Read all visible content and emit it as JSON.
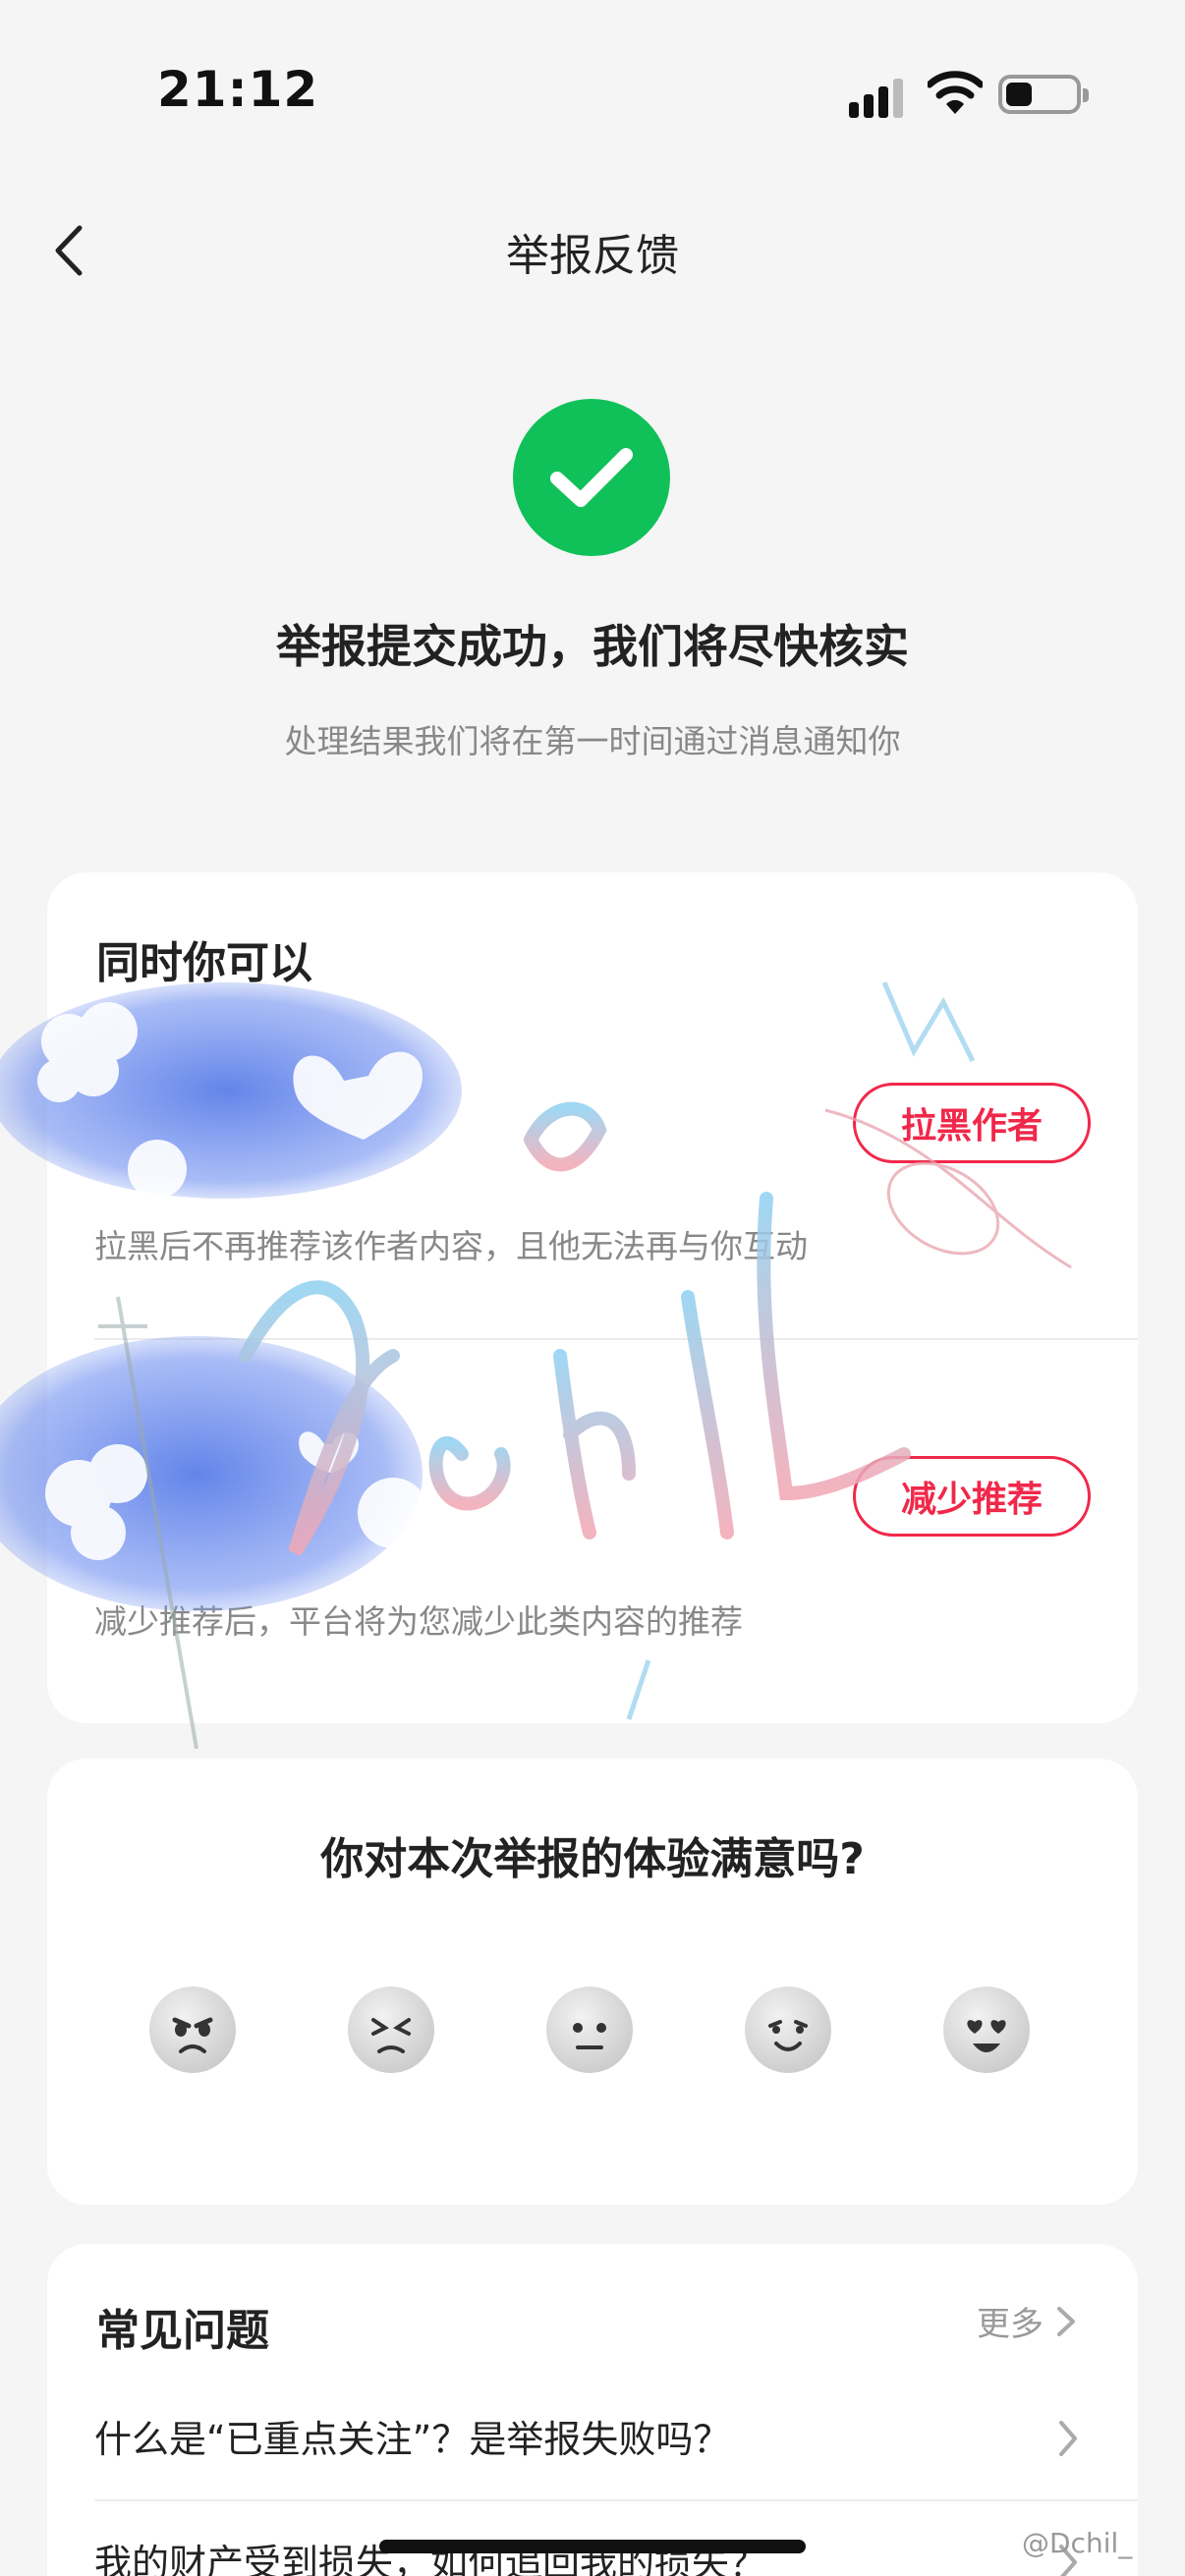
{
  "status_bar": {
    "time": "21:12"
  },
  "nav": {
    "title": "举报反馈"
  },
  "result": {
    "title": "举报提交成功，我们将尽快核实",
    "subtitle": "处理结果我们将在第一时间通过消息通知你",
    "accent": "#10c159"
  },
  "actions_card": {
    "heading": "同时你可以",
    "items": [
      {
        "button": "拉黑作者",
        "desc": "拉黑后不再推荐该作者内容，且他无法再与你互动"
      },
      {
        "button": "减少推荐",
        "desc": "减少推荐后，平台将为您减少此类内容的推荐"
      }
    ],
    "accent": "#f0284a"
  },
  "survey": {
    "title": "你对本次举报的体验满意吗?",
    "ratings": [
      "very-dissatisfied-icon",
      "dissatisfied-icon",
      "neutral-icon",
      "satisfied-icon",
      "very-satisfied-icon"
    ]
  },
  "faq": {
    "heading": "常见问题",
    "more": "更多",
    "items": [
      "什么是“已重点关注”？是举报失败吗？",
      "我的财产受到损失，如何追回我的损失？"
    ]
  },
  "watermark": {
    "tag": "@Dchil_"
  }
}
